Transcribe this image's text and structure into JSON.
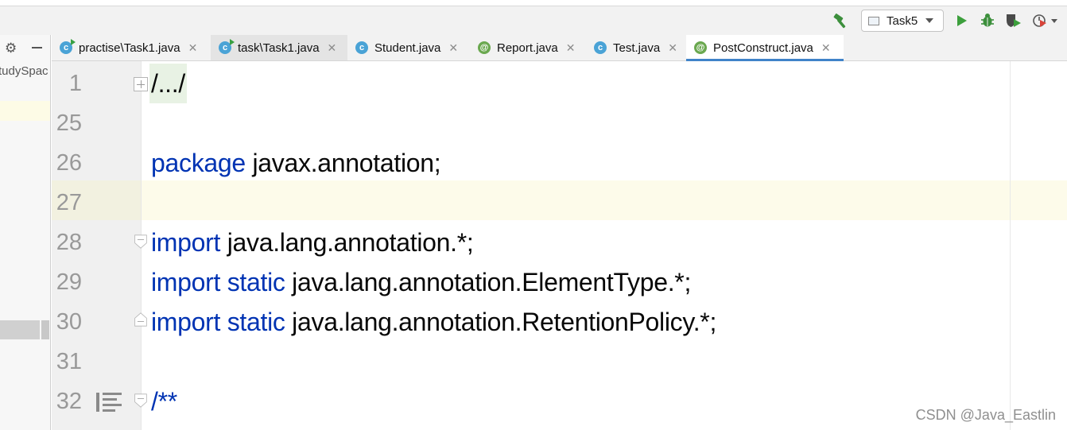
{
  "toolbar": {
    "run_config_label": "Task5",
    "icons": [
      "build-hammer-icon",
      "run-icon",
      "debug-icon",
      "coverage-icon",
      "profile-icon"
    ]
  },
  "project_panel": {
    "visible_text": "tudySpac"
  },
  "tabs": [
    {
      "label": "practise\\Task1.java",
      "icon": "class",
      "active": false
    },
    {
      "label": "task\\Task1.java",
      "icon": "class",
      "active": false
    },
    {
      "label": "Student.java",
      "icon": "class",
      "active": false
    },
    {
      "label": "Report.java",
      "icon": "annotation",
      "active": false
    },
    {
      "label": "Test.java",
      "icon": "class",
      "active": false
    },
    {
      "label": "PostConstruct.java",
      "icon": "annotation",
      "active": true
    }
  ],
  "editor": {
    "lines": [
      {
        "num": "1",
        "text": "/.../"
      },
      {
        "num": "25",
        "text": ""
      },
      {
        "num": "26",
        "kw": "package",
        "rest": " javax.annotation;"
      },
      {
        "num": "27",
        "text": ""
      },
      {
        "num": "28",
        "kw": "import",
        "rest": " java.lang.annotation.*;"
      },
      {
        "num": "29",
        "kw": "import static",
        "rest": " java.lang.annotation.ElementType.*;"
      },
      {
        "num": "30",
        "kw": "import static",
        "rest": " java.lang.annotation.RetentionPolicy.*;"
      },
      {
        "num": "31",
        "text": ""
      },
      {
        "num": "32",
        "comment": "/**"
      }
    ]
  },
  "watermark": "CSDN @Java_Eastlin",
  "colors": {
    "keyword": "#0033b3",
    "tab_underline": "#4083c9",
    "caret_row": "#fdfbea",
    "class_icon": "#4aa3d6",
    "annotation_icon": "#6aa84f"
  }
}
